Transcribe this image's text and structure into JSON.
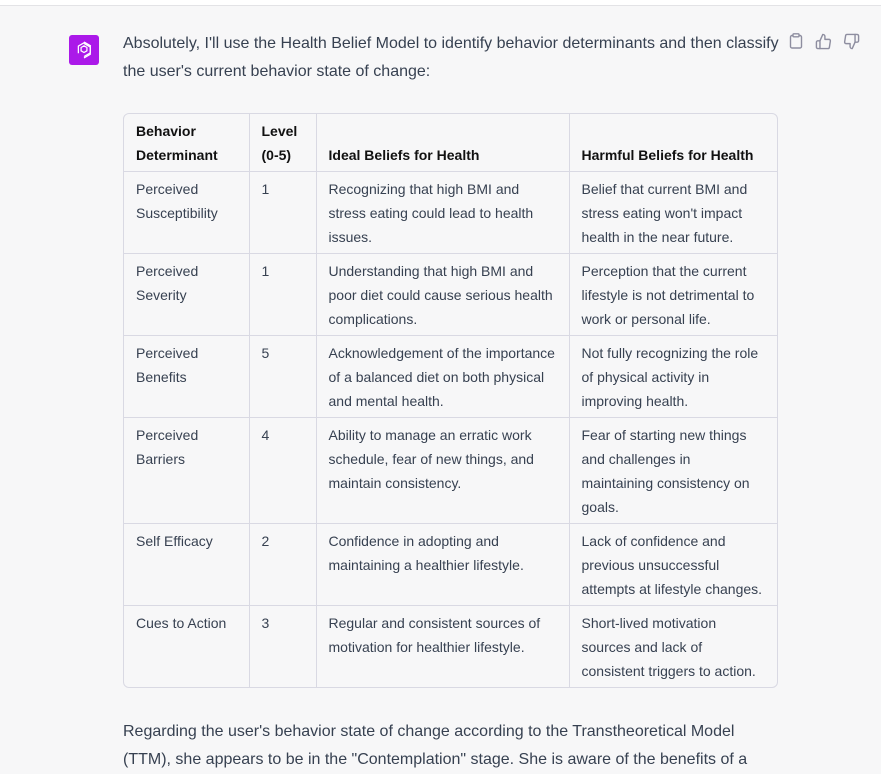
{
  "assistant": {
    "intro": "Absolutely, I'll use the Health Belief Model to identify behavior determinants and then classify the user's current behavior state of change:",
    "outro": "Regarding the user's behavior state of change according to the Transtheoretical Model (TTM), she appears to be in the \"Contemplation\" stage. She is aware of the benefits of a",
    "avatar_color": "#ab19e9"
  },
  "actions": {
    "icons": [
      "clipboard-icon",
      "thumbs-up-icon",
      "thumbs-down-icon"
    ]
  },
  "table": {
    "headers": [
      "Behavior Determinant",
      "Level (0-5)",
      "Ideal Beliefs for Health",
      "Harmful Beliefs for Health"
    ],
    "rows": [
      [
        "Perceived Susceptibility",
        "1",
        "Recognizing that high BMI and stress eating could lead to health issues.",
        "Belief that current BMI and stress eating won't impact health in the near future."
      ],
      [
        "Perceived Severity",
        "1",
        "Understanding that high BMI and poor diet could cause serious health complications.",
        "Perception that the current lifestyle is not detrimental to work or personal life."
      ],
      [
        "Perceived Benefits",
        "5",
        "Acknowledgement of the importance of a balanced diet on both physical and mental health.",
        "Not fully recognizing the role of physical activity in improving health."
      ],
      [
        "Perceived Barriers",
        "4",
        "Ability to manage an erratic work schedule, fear of new things, and maintain consistency.",
        "Fear of starting new things and challenges in maintaining consistency on goals."
      ],
      [
        "Self Efficacy",
        "2",
        "Confidence in adopting and maintaining a healthier lifestyle.",
        "Lack of confidence and previous unsuccessful attempts at lifestyle changes."
      ],
      [
        "Cues to Action",
        "3",
        "Regular and consistent sources of motivation for healthier lifestyle.",
        "Short-lived motivation sources and lack of consistent triggers to action."
      ]
    ]
  }
}
